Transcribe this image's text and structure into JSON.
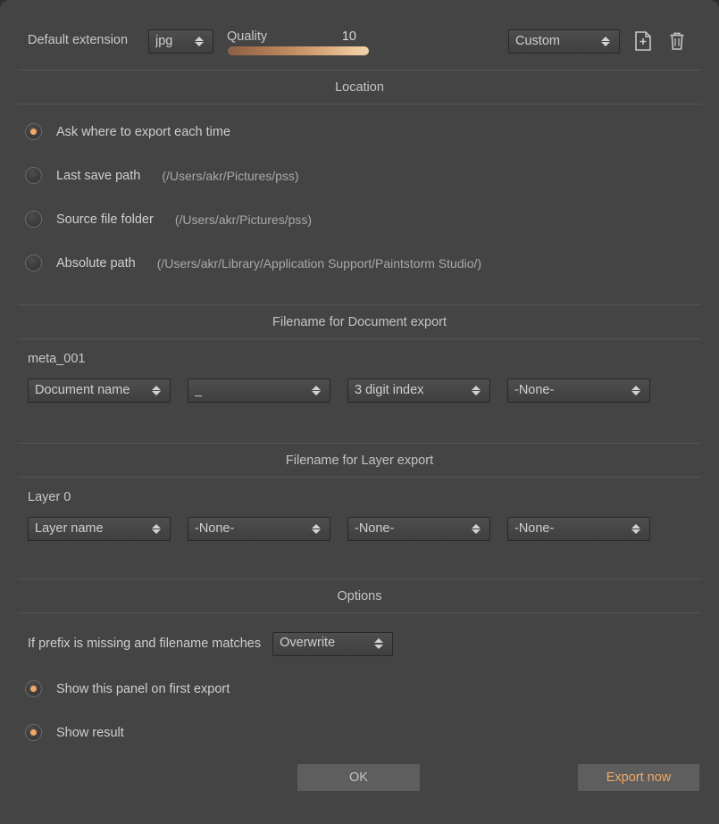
{
  "topbar": {
    "default_extension_label": "Default extension",
    "extension_value": "jpg",
    "quality_label": "Quality",
    "quality_value": "10",
    "preset_value": "Custom",
    "new_preset_icon": "new-document-plus-icon",
    "delete_preset_icon": "trash-icon"
  },
  "location": {
    "title": "Location",
    "options": [
      {
        "label": "Ask where to export each time",
        "path": "",
        "selected": true
      },
      {
        "label": "Last save path",
        "path": "(/Users/akr/Pictures/pss)",
        "selected": false
      },
      {
        "label": "Source file folder",
        "path": "(/Users/akr/Pictures/pss)",
        "selected": false
      },
      {
        "label": "Absolute path",
        "path": "(/Users/akr/Library/Application Support/Paintstorm Studio/)",
        "selected": false
      }
    ]
  },
  "document_export": {
    "title": "Filename for Document export",
    "preview": "meta_001",
    "parts": [
      "Document name",
      "_",
      "3 digit index",
      "-None-"
    ]
  },
  "layer_export": {
    "title": "Filename for Layer export",
    "preview": "Layer 0",
    "parts": [
      "Layer name",
      "-None-",
      "-None-",
      "-None-"
    ]
  },
  "options": {
    "title": "Options",
    "conflict_label": "If prefix is missing and filename matches",
    "conflict_value": "Overwrite",
    "toggles": [
      {
        "label": "Show this panel on first export",
        "selected": true
      },
      {
        "label": "Show result",
        "selected": true
      }
    ]
  },
  "footer": {
    "ok_label": "OK",
    "export_label": "Export now"
  },
  "colors": {
    "panel_bg": "#444444",
    "accent": "#f0a868",
    "text": "#c9c9c9"
  }
}
